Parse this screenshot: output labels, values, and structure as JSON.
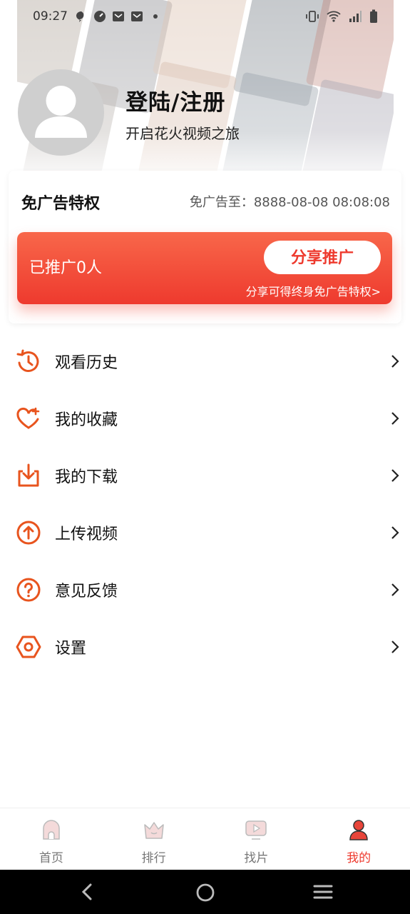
{
  "status_bar": {
    "time": "09:27"
  },
  "profile": {
    "title": "登陆/注册",
    "subtitle": "开启花火视频之旅"
  },
  "privilege": {
    "title": "免广告特权",
    "expiry_label": "免广告至：",
    "expiry_value": "8888-08-08 08:08:08",
    "promoted_text": "已推广0人",
    "share_button": "分享推广",
    "share_hint": "分享可得终身免广告特权>"
  },
  "menu": {
    "items": [
      {
        "label": "观看历史",
        "icon": "history-icon"
      },
      {
        "label": "我的收藏",
        "icon": "favorite-heart-icon"
      },
      {
        "label": "我的下载",
        "icon": "download-icon"
      },
      {
        "label": "上传视频",
        "icon": "upload-icon"
      },
      {
        "label": "意见反馈",
        "icon": "question-icon"
      },
      {
        "label": "设置",
        "icon": "settings-hex-icon"
      }
    ]
  },
  "bottom_nav": {
    "items": [
      {
        "label": "首页",
        "icon": "home-icon",
        "active": false
      },
      {
        "label": "排行",
        "icon": "crown-icon",
        "active": false
      },
      {
        "label": "找片",
        "icon": "video-play-icon",
        "active": false
      },
      {
        "label": "我的",
        "icon": "user-icon",
        "active": true
      }
    ]
  },
  "colors": {
    "accent": "#ee3a2e",
    "icon_orange": "#e8541e",
    "inactive": "#777777"
  }
}
